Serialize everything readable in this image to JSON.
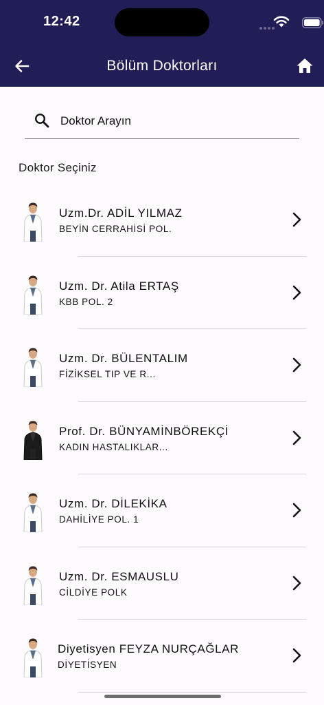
{
  "status_bar": {
    "time": "12:42"
  },
  "header": {
    "title": "Bölüm Doktorları"
  },
  "search": {
    "placeholder": "Doktor Arayın"
  },
  "section_label": "Doktor Seçiniz",
  "doctors": [
    {
      "name": "Uzm.Dr. ADİL YILMAZ",
      "department": "BEYİN CERRAHİSİ POL.",
      "coat": "#ffffff"
    },
    {
      "name": "Uzm. Dr. Atila ERTAŞ",
      "department": "KBB POL. 2",
      "coat": "#ffffff"
    },
    {
      "name": "Uzm. Dr. BÜLENTALIM",
      "department": "FİZİKSEL TIP VE R...",
      "coat": "#ffffff"
    },
    {
      "name": "Prof. Dr. BÜNYAMİNBÖREKÇİ",
      "department": "KADIN HASTALIKLAR...",
      "coat": "#1b1b1b"
    },
    {
      "name": "Uzm. Dr. DİLEKİKA",
      "department": "DAHİLİYE POL. 1",
      "coat": "#ffffff"
    },
    {
      "name": "Uzm. Dr. ESMAUSLU",
      "department": "CİLDİYE POLK",
      "coat": "#ffffff"
    },
    {
      "name": "Diyetisyen FEYZA NURÇAĞLAR",
      "department": "DİYETİSYEN",
      "coat": "#ffffff"
    }
  ],
  "colors": {
    "header_bg": "#211d57",
    "background": "#fdfbfd"
  }
}
